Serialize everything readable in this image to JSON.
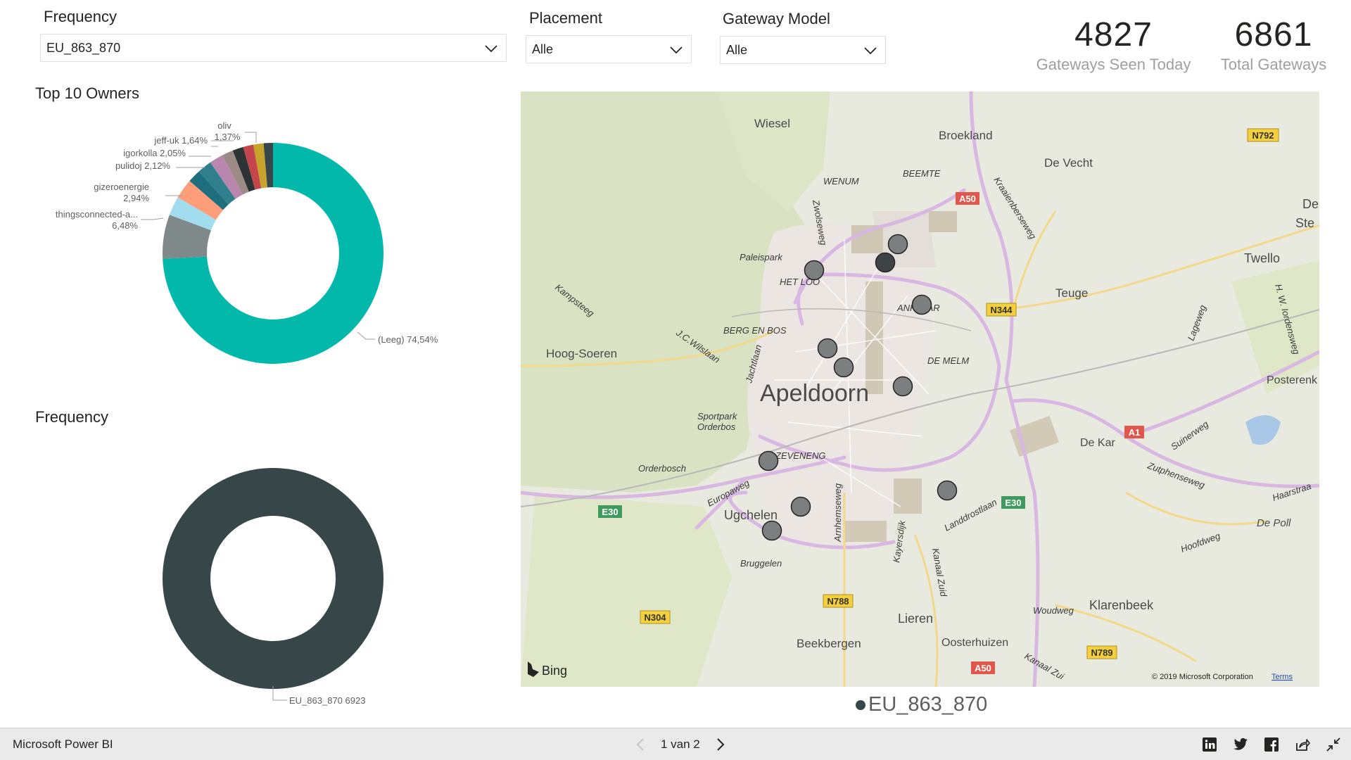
{
  "slicers": {
    "frequency": {
      "title": "Frequency",
      "value": "EU_863_870"
    },
    "placement": {
      "title": "Placement",
      "value": "Alle"
    },
    "gateway_model": {
      "title": "Gateway Model",
      "value": "Alle"
    }
  },
  "kpis": [
    {
      "value": "4827",
      "label": "Gateways Seen Today"
    },
    {
      "value": "6861",
      "label": "Total Gateways"
    }
  ],
  "owners_chart": {
    "title": "Top 10 Owners",
    "labels": {
      "oliv_name": "oliv",
      "oliv_pct": "1,37%",
      "jeff": "jeff-uk 1,64%",
      "igor": "igorkolla 2,05%",
      "puli": "pulidoj 2,12%",
      "gizero_name": "gizeroenergie",
      "gizero_pct": "2,94%",
      "things_name": "thingsconnected-a...",
      "things_pct": "6,48%",
      "leeg": "(Leeg) 74,54%"
    }
  },
  "frequency_chart": {
    "title": "Frequency",
    "label": "EU_863_870 6923"
  },
  "chart_data": [
    {
      "type": "pie",
      "title": "Top 10 Owners",
      "categories": [
        "(Leeg)",
        "thingsconnected-a...",
        "",
        "gizeroenergie",
        "",
        "pulidoj",
        "igorkolla",
        "jeff-uk",
        "",
        "",
        "",
        "oliv"
      ],
      "values": [
        74.54,
        6.48,
        2.8,
        2.94,
        1.9,
        2.12,
        2.05,
        1.64,
        1.6,
        1.5,
        1.5,
        1.37
      ],
      "colors": [
        "#01b8aa",
        "#7f898a",
        "#a2dcef",
        "#fd9d7a",
        "#1f6e80",
        "#2f7f8c",
        "#b887ad",
        "#9c8a86",
        "#2d3436",
        "#c4454c",
        "#c8a32c",
        "#374649"
      ]
    },
    {
      "type": "pie",
      "title": "Frequency",
      "categories": [
        "EU_863_870"
      ],
      "values": [
        6923
      ],
      "colors": [
        "#374649"
      ]
    }
  ],
  "map": {
    "legend": "EU_863_870",
    "bing_label": "Bing",
    "copyright": "© 2019 Microsoft Corporation",
    "terms": "Terms",
    "places": {
      "apeldoorn": "Apeldoorn",
      "wiesel": "Wiesel",
      "broekland": "Broekland",
      "devecht": "De Vecht",
      "twello": "Twello",
      "teuge": "Teuge",
      "hoogsoeren": "Hoog-Soeren",
      "ugchelen": "Ugchelen",
      "lieren": "Lieren",
      "beekbergen": "Beekbergen",
      "oosterhuizen": "Oosterhuizen",
      "klarenbeek": "Klarenbeek",
      "dekar": "De Kar",
      "posterenk": "Posterenk",
      "depoll": "De Poll",
      "de": "De",
      "ste": "Ste",
      "orderbosch": "Orderbosch",
      "paleispark": "Paleispark",
      "hetloo": "HET LOO",
      "wenum": "WENUM",
      "beemte": "BEEMTE",
      "bergenbos": "BERG EN BOS",
      "demelm": "DE MELM",
      "anklaar": "ANKLAAR",
      "zevenhuizen": "ZEVENENG",
      "sportpark": "Sportpark",
      "orderbos": "Orderbos",
      "bruggelen": "Bruggelen"
    },
    "roads": {
      "a50": "A50",
      "a1": "A1",
      "e30a": "E30",
      "e30b": "E30",
      "n344": "N344",
      "n792": "N792",
      "n788": "N788",
      "n304": "N304",
      "n789": "N789",
      "a50b": "A50",
      "zwolseweg": "Zwolseweg",
      "kampsteeg": "Kampsteeg",
      "jcwilslaan": "J.C.Wilslaan",
      "jachtlaan": "Jachtlaan",
      "europaweg": "Europaweg",
      "arnhemseweg": "Arnhemseweg",
      "kayersdijk": "Kayersdijk",
      "kanaalzuid": "Kanaal Zuid",
      "landdrosten": "Landdrostlaan",
      "zutphenseweg": "Zutphenseweg",
      "hoofdweg": "Hoofdweg",
      "woudweg": "Woudweg",
      "kanaalzui2": "Kanaal Zui",
      "kraaijenweg": "Kraaienberseweg",
      "hwiordensweg": "H. W. Iordensweg",
      "haarstraat": "Haarstraa",
      "suinerweg": "Suinerweg",
      "lageweg": "Lageweg"
    }
  },
  "footer": {
    "brand": "Microsoft Power BI",
    "page": "1 van 2"
  }
}
